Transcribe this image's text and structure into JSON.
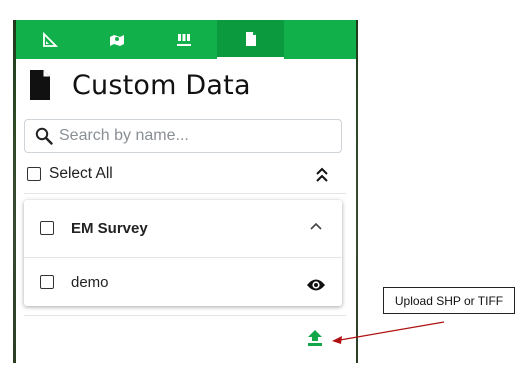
{
  "colors": {
    "accent": "#12b04a",
    "upload_icon": "#12a84a",
    "annotation": "#b01010"
  },
  "tabs": [
    {
      "icon": "ruler-icon",
      "active": false
    },
    {
      "icon": "map-layers-icon",
      "active": false
    },
    {
      "icon": "field-markers-icon",
      "active": false
    },
    {
      "icon": "document-icon",
      "active": true
    }
  ],
  "header": {
    "title": "Custom Data",
    "icon": "document-icon"
  },
  "search": {
    "placeholder": "Search by name...",
    "value": ""
  },
  "select_all": {
    "label": "Select All",
    "checked": false
  },
  "layers": [
    {
      "name": "EM Survey",
      "checked": false,
      "expanded": true,
      "children": [
        {
          "name": "demo",
          "checked": false,
          "visible": true
        }
      ]
    }
  ],
  "annotation": {
    "text": "Upload SHP or TIFF"
  }
}
